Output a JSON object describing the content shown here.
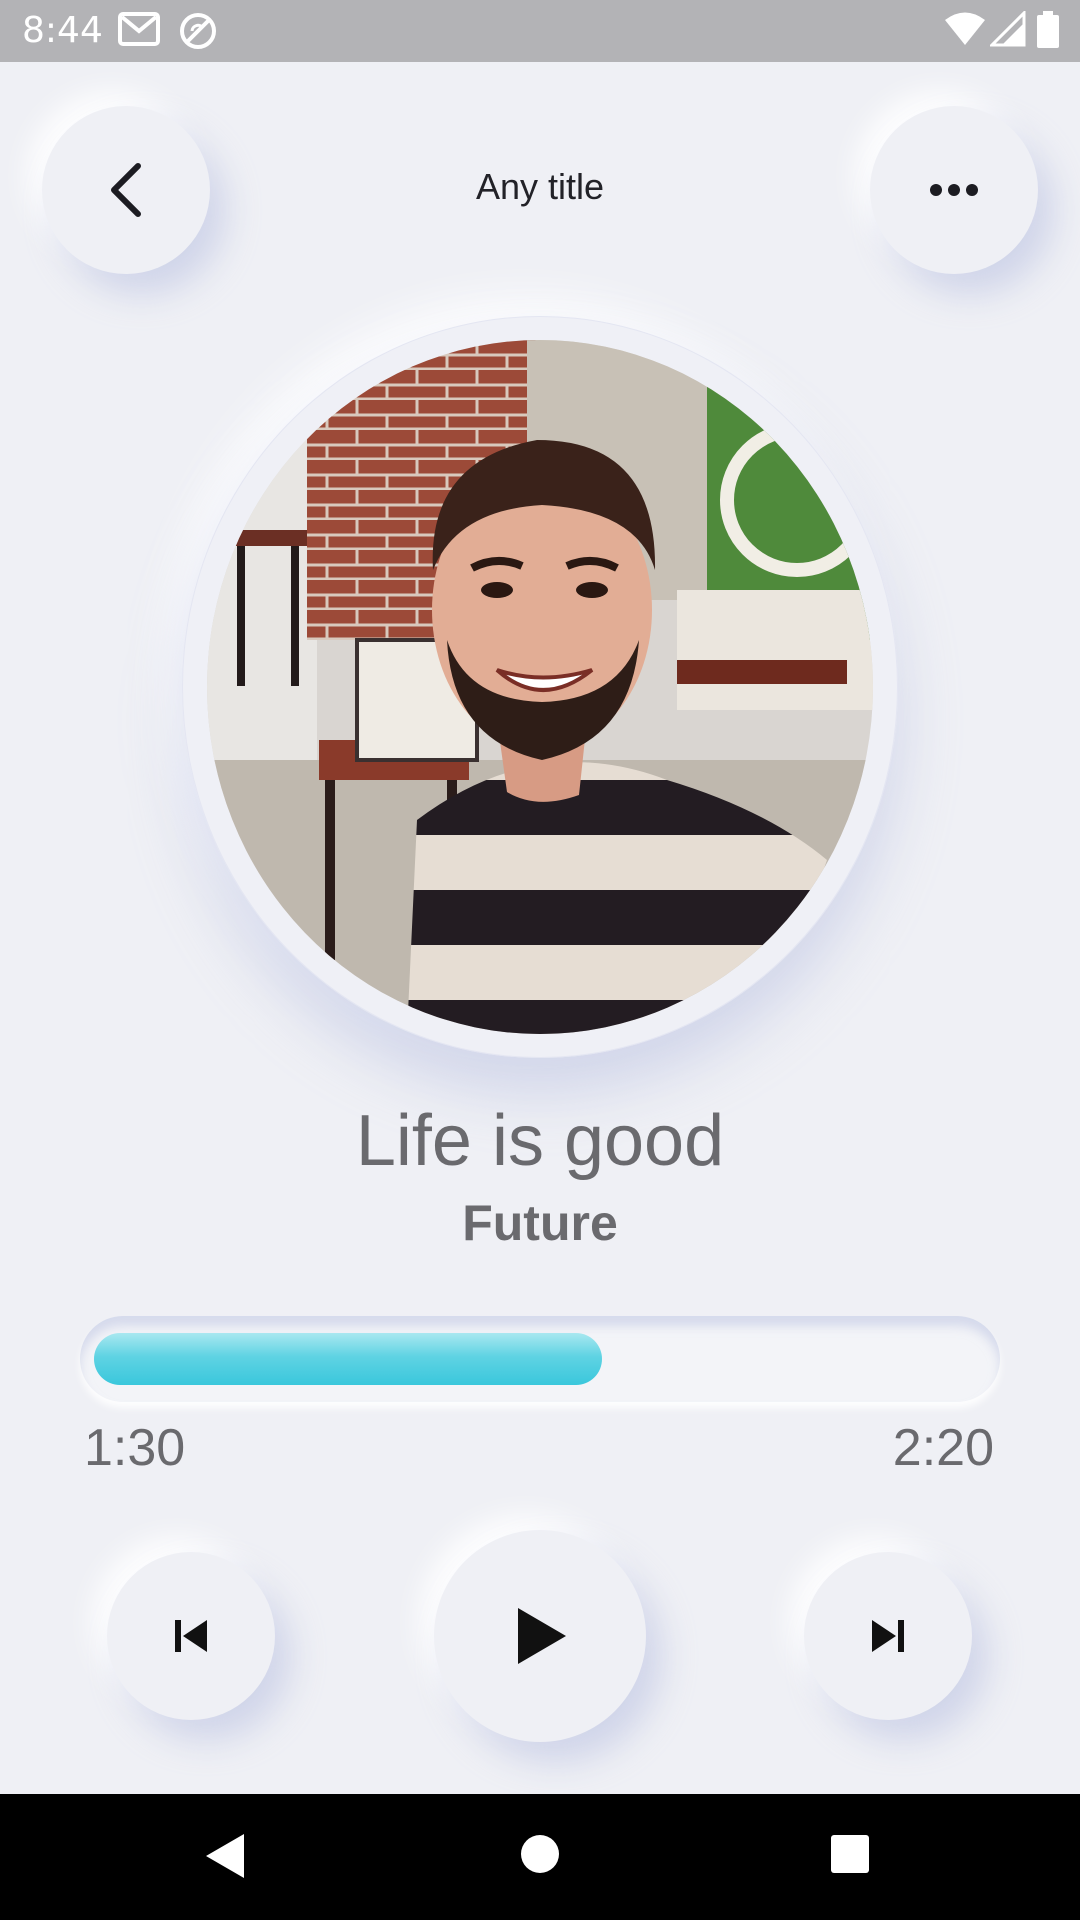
{
  "status_bar": {
    "time": "8:44",
    "left_icons": [
      "gmail-icon",
      "sync-disabled-icon"
    ],
    "right_icons": [
      "wifi-icon",
      "cell-signal-icon",
      "battery-icon"
    ]
  },
  "header": {
    "title": "Any title",
    "back_icon": "chevron-left-icon",
    "more_icon": "more-horizontal-icon"
  },
  "album_art": {
    "description_icon": "album-art-image"
  },
  "track": {
    "title": "Life is good",
    "artist": "Future"
  },
  "progress": {
    "elapsed": "1:30",
    "total": "2:20",
    "fraction": 0.6,
    "fill_color": "#3ac7dc"
  },
  "controls": {
    "previous_icon": "skip-previous-icon",
    "play_icon": "play-icon",
    "next_icon": "skip-next-icon"
  },
  "nav_bar": {
    "back_icon": "nav-back-icon",
    "home_icon": "nav-home-icon",
    "recents_icon": "nav-recents-icon"
  }
}
